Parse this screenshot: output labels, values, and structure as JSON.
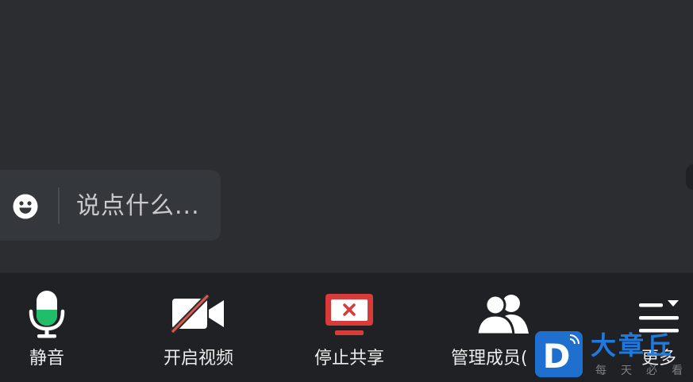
{
  "chat": {
    "placeholder": "说点什么..."
  },
  "toolbar": {
    "items": [
      {
        "label": "静音",
        "icon": "microphone-icon"
      },
      {
        "label": "开启视频",
        "icon": "video-off-icon"
      },
      {
        "label": "停止共享",
        "icon": "stop-share-icon"
      },
      {
        "label": "管理成员(",
        "icon": "members-icon"
      },
      {
        "label": "更多",
        "icon": "more-icon"
      }
    ]
  },
  "watermark": {
    "brand": "大章丘",
    "slogan": "每天必看",
    "logo_letter": "D"
  },
  "colors": {
    "background": "#2b2d31",
    "toolbar": "#202124",
    "mic_level": "#1fbf6a",
    "share_red": "#d93a3a",
    "brand_blue": "#1f7ae0"
  }
}
